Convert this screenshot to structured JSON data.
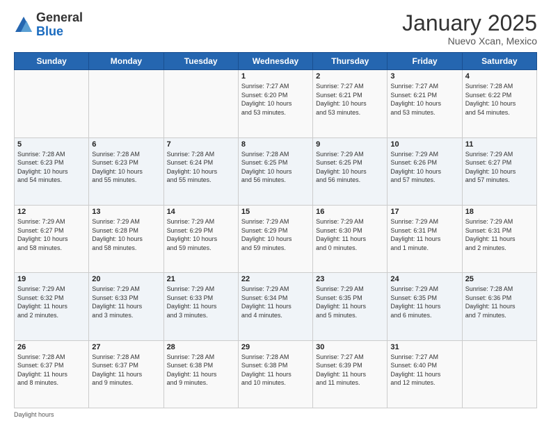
{
  "header": {
    "logo_general": "General",
    "logo_blue": "Blue",
    "month_title": "January 2025",
    "location": "Nuevo Xcan, Mexico"
  },
  "days_of_week": [
    "Sunday",
    "Monday",
    "Tuesday",
    "Wednesday",
    "Thursday",
    "Friday",
    "Saturday"
  ],
  "weeks": [
    [
      {
        "day": "",
        "detail": ""
      },
      {
        "day": "",
        "detail": ""
      },
      {
        "day": "",
        "detail": ""
      },
      {
        "day": "1",
        "detail": "Sunrise: 7:27 AM\nSunset: 6:20 PM\nDaylight: 10 hours\nand 53 minutes."
      },
      {
        "day": "2",
        "detail": "Sunrise: 7:27 AM\nSunset: 6:21 PM\nDaylight: 10 hours\nand 53 minutes."
      },
      {
        "day": "3",
        "detail": "Sunrise: 7:27 AM\nSunset: 6:21 PM\nDaylight: 10 hours\nand 53 minutes."
      },
      {
        "day": "4",
        "detail": "Sunrise: 7:28 AM\nSunset: 6:22 PM\nDaylight: 10 hours\nand 54 minutes."
      }
    ],
    [
      {
        "day": "5",
        "detail": "Sunrise: 7:28 AM\nSunset: 6:23 PM\nDaylight: 10 hours\nand 54 minutes."
      },
      {
        "day": "6",
        "detail": "Sunrise: 7:28 AM\nSunset: 6:23 PM\nDaylight: 10 hours\nand 55 minutes."
      },
      {
        "day": "7",
        "detail": "Sunrise: 7:28 AM\nSunset: 6:24 PM\nDaylight: 10 hours\nand 55 minutes."
      },
      {
        "day": "8",
        "detail": "Sunrise: 7:28 AM\nSunset: 6:25 PM\nDaylight: 10 hours\nand 56 minutes."
      },
      {
        "day": "9",
        "detail": "Sunrise: 7:29 AM\nSunset: 6:25 PM\nDaylight: 10 hours\nand 56 minutes."
      },
      {
        "day": "10",
        "detail": "Sunrise: 7:29 AM\nSunset: 6:26 PM\nDaylight: 10 hours\nand 57 minutes."
      },
      {
        "day": "11",
        "detail": "Sunrise: 7:29 AM\nSunset: 6:27 PM\nDaylight: 10 hours\nand 57 minutes."
      }
    ],
    [
      {
        "day": "12",
        "detail": "Sunrise: 7:29 AM\nSunset: 6:27 PM\nDaylight: 10 hours\nand 58 minutes."
      },
      {
        "day": "13",
        "detail": "Sunrise: 7:29 AM\nSunset: 6:28 PM\nDaylight: 10 hours\nand 58 minutes."
      },
      {
        "day": "14",
        "detail": "Sunrise: 7:29 AM\nSunset: 6:29 PM\nDaylight: 10 hours\nand 59 minutes."
      },
      {
        "day": "15",
        "detail": "Sunrise: 7:29 AM\nSunset: 6:29 PM\nDaylight: 10 hours\nand 59 minutes."
      },
      {
        "day": "16",
        "detail": "Sunrise: 7:29 AM\nSunset: 6:30 PM\nDaylight: 11 hours\nand 0 minutes."
      },
      {
        "day": "17",
        "detail": "Sunrise: 7:29 AM\nSunset: 6:31 PM\nDaylight: 11 hours\nand 1 minute."
      },
      {
        "day": "18",
        "detail": "Sunrise: 7:29 AM\nSunset: 6:31 PM\nDaylight: 11 hours\nand 2 minutes."
      }
    ],
    [
      {
        "day": "19",
        "detail": "Sunrise: 7:29 AM\nSunset: 6:32 PM\nDaylight: 11 hours\nand 2 minutes."
      },
      {
        "day": "20",
        "detail": "Sunrise: 7:29 AM\nSunset: 6:33 PM\nDaylight: 11 hours\nand 3 minutes."
      },
      {
        "day": "21",
        "detail": "Sunrise: 7:29 AM\nSunset: 6:33 PM\nDaylight: 11 hours\nand 3 minutes."
      },
      {
        "day": "22",
        "detail": "Sunrise: 7:29 AM\nSunset: 6:34 PM\nDaylight: 11 hours\nand 4 minutes."
      },
      {
        "day": "23",
        "detail": "Sunrise: 7:29 AM\nSunset: 6:35 PM\nDaylight: 11 hours\nand 5 minutes."
      },
      {
        "day": "24",
        "detail": "Sunrise: 7:29 AM\nSunset: 6:35 PM\nDaylight: 11 hours\nand 6 minutes."
      },
      {
        "day": "25",
        "detail": "Sunrise: 7:28 AM\nSunset: 6:36 PM\nDaylight: 11 hours\nand 7 minutes."
      }
    ],
    [
      {
        "day": "26",
        "detail": "Sunrise: 7:28 AM\nSunset: 6:37 PM\nDaylight: 11 hours\nand 8 minutes."
      },
      {
        "day": "27",
        "detail": "Sunrise: 7:28 AM\nSunset: 6:37 PM\nDaylight: 11 hours\nand 9 minutes."
      },
      {
        "day": "28",
        "detail": "Sunrise: 7:28 AM\nSunset: 6:38 PM\nDaylight: 11 hours\nand 9 minutes."
      },
      {
        "day": "29",
        "detail": "Sunrise: 7:28 AM\nSunset: 6:38 PM\nDaylight: 11 hours\nand 10 minutes."
      },
      {
        "day": "30",
        "detail": "Sunrise: 7:27 AM\nSunset: 6:39 PM\nDaylight: 11 hours\nand 11 minutes."
      },
      {
        "day": "31",
        "detail": "Sunrise: 7:27 AM\nSunset: 6:40 PM\nDaylight: 11 hours\nand 12 minutes."
      },
      {
        "day": "",
        "detail": ""
      }
    ]
  ],
  "footer": {
    "daylight_hours": "Daylight hours"
  }
}
